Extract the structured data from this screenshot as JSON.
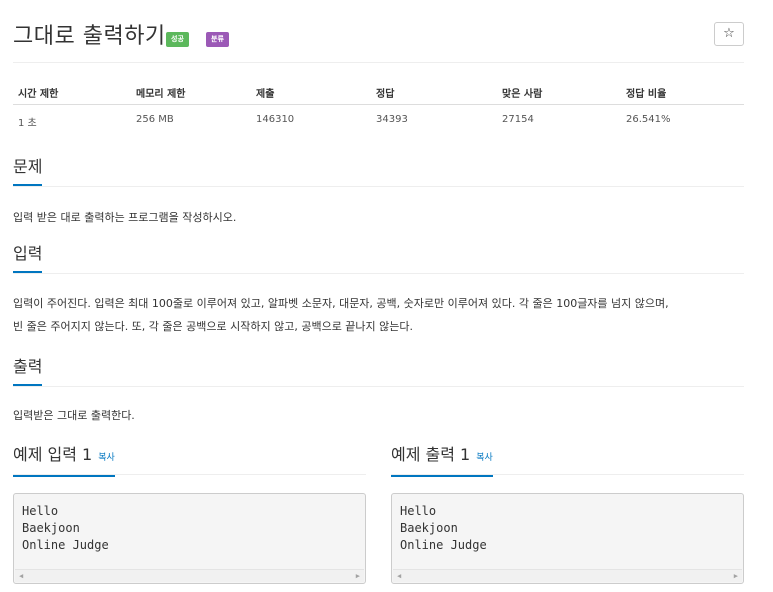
{
  "problem": {
    "title": "그대로 출력하기",
    "badges": {
      "success": "성공",
      "category": "분류"
    },
    "star_icon": "☆"
  },
  "stats": {
    "headers": [
      "시간 제한",
      "메모리 제한",
      "제출",
      "정답",
      "맞은 사람",
      "정답 비율"
    ],
    "values": [
      "1 초",
      "256 MB",
      "146310",
      "34393",
      "27154",
      "26.541%"
    ]
  },
  "sections": {
    "problem": {
      "title": "문제",
      "text": "입력 받은 대로 출력하는 프로그램을 작성하시오."
    },
    "input": {
      "title": "입력",
      "line1": "입력이 주어진다. 입력은 최대 100줄로 이루어져 있고, 알파벳 소문자, 대문자, 공백, 숫자로만 이루어져 있다. 각 줄은 100글자를 넘지 않으며,",
      "line2": "빈 줄은 주어지지 않는다. 또, 각 줄은 공백으로 시작하지 않고, 공백으로 끝나지 않는다."
    },
    "output": {
      "title": "출력",
      "text": "입력받은 그대로 출력한다."
    }
  },
  "samples": {
    "copy_label": "복사",
    "input": {
      "title": "예제 입력 1",
      "lines": [
        "Hello",
        "Baekjoon",
        "Online Judge"
      ]
    },
    "output": {
      "title": "예제 출력 1",
      "lines": [
        "Hello",
        "Baekjoon",
        "Online Judge"
      ]
    },
    "scroll_left": "◀",
    "scroll_right": "▶"
  },
  "colors": {
    "accent": "#0076c0",
    "success": "#5cb85c",
    "category": "#9b59b6"
  }
}
